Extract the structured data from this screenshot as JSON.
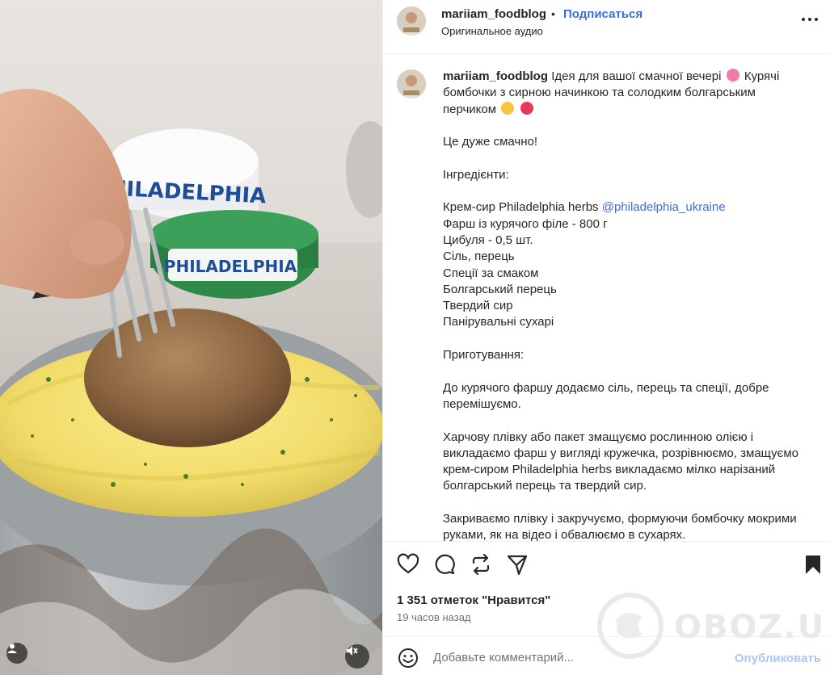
{
  "post": {
    "username": "mariiam_foodblog",
    "follow_label": "Подписаться",
    "audio": "Оригинальное аудио",
    "separator": "•"
  },
  "caption": {
    "username": "mariiam_foodblog",
    "intro_a": "Ідея для вашої смачної вечері",
    "intro_b": "Курячі бомбочки з сирною начинкою та солодким болгарським перчиком",
    "line_tasty": "Це дуже смачно!",
    "ingredients_title": "Інгредієнти:",
    "ingredient_1": "Крем-сир Philadelphia herbs",
    "mention": "@philadelphia_ukraine",
    "ingredient_2": "Фарш із курячого філе - 800 г",
    "ingredient_3": "Цибуля - 0,5 шт.",
    "ingredient_4": "Сіль, перець",
    "ingredient_5": "Спеції за смаком",
    "ingredient_6": "Болгарський перець",
    "ingredient_7": "Твердий сир",
    "ingredient_8": "Панірувальні сухарі",
    "prep_title": "Приготування:",
    "step_1": "До курячого фаршу додаємо сіль, перець та спеції, добре перемішуємо.",
    "step_2": "Харчову плівку або пакет змащуємо рослинною олією і викладаємо фарш у вигляді кружечка, розрівнюємо, змащуємо крем-сиром Philadelphia herbs викладаємо мілко нарізаний болгарський перець та твердий сир.",
    "step_3": "Закриваємо плівку і закручуємо, формуючи бомбочку мокрими руками, як на відео і обвалюємо в сухарях."
  },
  "media": {
    "package_text": "PHILADELPHIA",
    "package_text_2": "PHILADELPHIA"
  },
  "actions": {
    "likes": "1 351 отметок \"Нравится\"",
    "time": "19 часов назад"
  },
  "comment": {
    "placeholder": "Добавьте комментарий...",
    "post_label": "Опубликовать"
  },
  "watermark": {
    "text": "OBOZ.UA"
  },
  "colors": {
    "accent": "#3c6ed8",
    "text": "#262626",
    "muted": "#737373",
    "border": "#efefef"
  }
}
